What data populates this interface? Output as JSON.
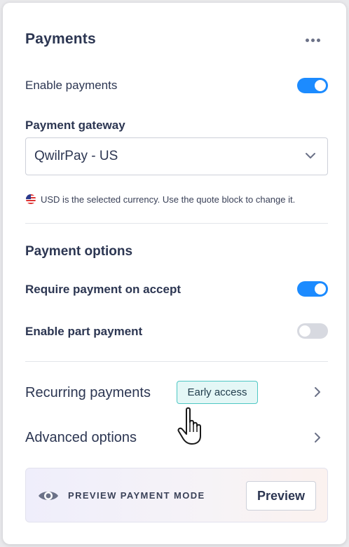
{
  "panel": {
    "title": "Payments",
    "more_icon": "more-horizontal-icon"
  },
  "enable_payments": {
    "label": "Enable payments",
    "enabled": true
  },
  "gateway": {
    "label": "Payment gateway",
    "selected": "QwilrPay - US",
    "chevron_icon": "chevron-down-icon"
  },
  "currency_note": {
    "flag_icon": "us-flag-icon",
    "text": "USD is the selected currency. Use the quote block to change it."
  },
  "payment_options": {
    "heading": "Payment options",
    "require_payment": {
      "label": "Require payment on accept",
      "enabled": true
    },
    "part_payment": {
      "label": "Enable part payment",
      "enabled": false
    }
  },
  "recurring": {
    "label": "Recurring payments",
    "badge": "Early access",
    "arrow_icon": "chevron-right-icon"
  },
  "advanced": {
    "label": "Advanced options",
    "arrow_icon": "chevron-right-icon"
  },
  "preview": {
    "eye_icon": "eye-icon",
    "mode_label": "PREVIEW PAYMENT MODE",
    "button_label": "Preview"
  },
  "colors": {
    "accent": "#1c8bff",
    "text": "#2c3652",
    "badge_border": "#4ec7c4",
    "badge_bg": "#e4f7f6"
  }
}
